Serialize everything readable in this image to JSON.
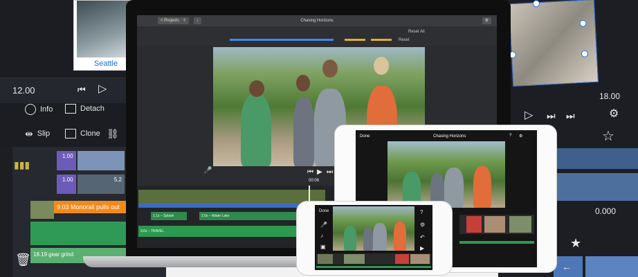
{
  "left_panel": {
    "time_start": "12.00",
    "photo_caption": "Seattle",
    "tools": {
      "info": "Info",
      "detach": "Detach",
      "slip": "Slip",
      "clone": "Clone"
    },
    "clips": {
      "purple_1_value": "1.00",
      "purple_2_value": "1.00",
      "second_clip_value": "5.2",
      "orange_clip_value": "9.03",
      "orange_clip_label": "Monorail pulls out",
      "green_clip_value": "18.19",
      "green_clip_label": "gear grind"
    }
  },
  "laptop_app": {
    "window_title": "Chasing Horizons",
    "projects_button": "< Projects",
    "reset_all": "Reset All",
    "reset": "Reset",
    "timecode": "00:06",
    "track_labels": {
      "audio_1": "1.1s – Splash",
      "audio_2": "2.6s – Water Lake",
      "audio_3": "9.6s – TRAVEL"
    }
  },
  "ipad_app": {
    "done": "Done",
    "title": "Chasing Horizons"
  },
  "iphone_app": {
    "done": "Done"
  },
  "right_panel": {
    "time_end": "18.00",
    "value_readout": "0.000"
  }
}
